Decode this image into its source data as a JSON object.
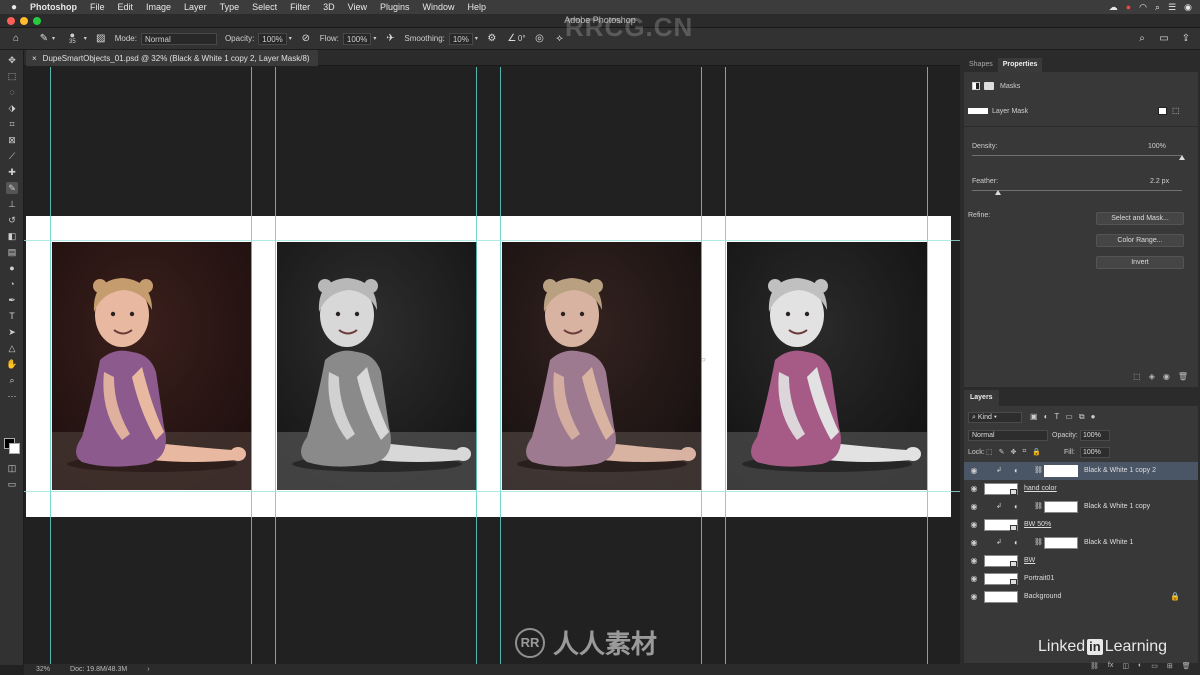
{
  "menubar": {
    "apple": "",
    "items": [
      "Photoshop",
      "File",
      "Edit",
      "Image",
      "Layer",
      "Type",
      "Select",
      "Filter",
      "3D",
      "View",
      "Plugins",
      "Window",
      "Help"
    ]
  },
  "window": {
    "title": "Adobe Photoshop"
  },
  "options": {
    "brush_size": "35",
    "mode_label": "Mode:",
    "mode_value": "Normal",
    "opacity_label": "Opacity:",
    "opacity_value": "100%",
    "flow_label": "Flow:",
    "flow_value": "100%",
    "smoothing_label": "Smoothing:",
    "smoothing_value": "10%",
    "angle_value": "0°"
  },
  "document": {
    "tab_title": "DupeSmartObjects_01.psd @ 32% (Black & White 1 copy 2, Layer Mask/8)"
  },
  "status": {
    "zoom": "32%",
    "doc": "Doc: 19.8M/48.3M"
  },
  "panels": {
    "tabs": [
      "Shapes",
      "Properties"
    ],
    "properties": {
      "masks_label": "Masks",
      "layer_mask_label": "Layer Mask",
      "density_label": "Density:",
      "density_value": "100%",
      "density_fraction": 1.0,
      "feather_label": "Feather:",
      "feather_value": "2.2 px",
      "refine_label": "Refine:",
      "select_and_mask": "Select and Mask...",
      "color_range": "Color Range...",
      "invert": "Invert"
    },
    "layers": {
      "tab": "Layers",
      "kind": "Kind",
      "blend_mode": "Normal",
      "opacity_label": "Opacity:",
      "opacity_value": "100%",
      "lock_label": "Lock:",
      "fill_label": "Fill:",
      "fill_value": "100%",
      "items": [
        {
          "name": "Black & White 1 copy 2",
          "type": "adjustment",
          "selected": true
        },
        {
          "name": "hand color",
          "type": "smart",
          "selected": false
        },
        {
          "name": "Black & White 1 copy",
          "type": "adjustment",
          "selected": false
        },
        {
          "name": "BW 50%",
          "type": "smart",
          "selected": false
        },
        {
          "name": "Black & White 1",
          "type": "adjustment",
          "selected": false
        },
        {
          "name": "BW",
          "type": "smart",
          "selected": false
        },
        {
          "name": "Portrait01",
          "type": "smart",
          "selected": false
        },
        {
          "name": "Background",
          "type": "background",
          "selected": false
        }
      ]
    }
  },
  "branding": {
    "linkedin_a": "Linked",
    "linkedin_b": "in",
    "linkedin_c": " Learning",
    "watermark_top": "RRCG.CN",
    "watermark_bottom": "人人素材"
  },
  "colors": {
    "guide": "#5fd0c6",
    "dress_color": "#8c5a8c",
    "skin_color": "#e0b49a",
    "selected_layer": "#4a5566"
  },
  "photos": [
    {
      "variant": "color"
    },
    {
      "variant": "bw"
    },
    {
      "variant": "muted"
    },
    {
      "variant": "handcolor"
    }
  ]
}
